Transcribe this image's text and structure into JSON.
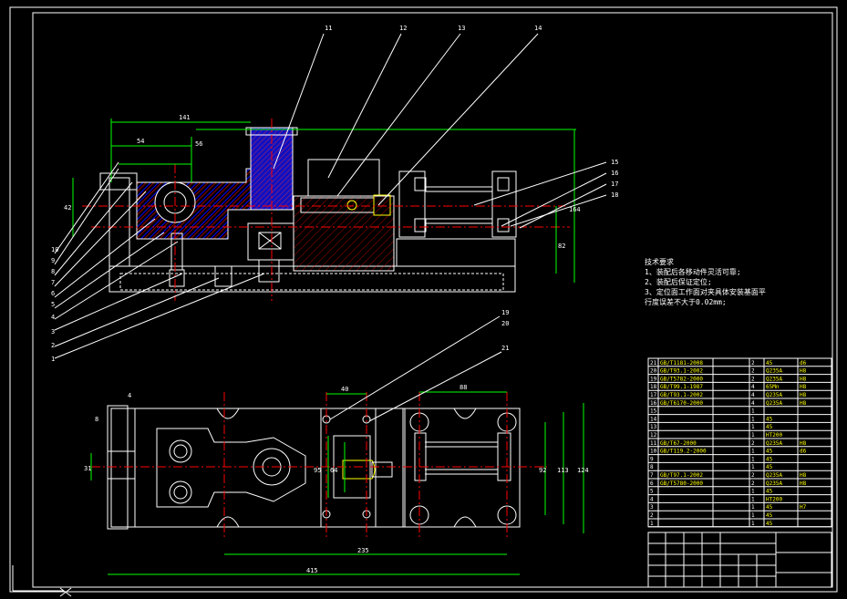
{
  "drawing": {
    "balloons_front": [
      "11",
      "12",
      "13",
      "14",
      "15",
      "16",
      "17",
      "18"
    ],
    "balloons_left": [
      "10",
      "9",
      "8",
      "7",
      "6",
      "5",
      "4",
      "3",
      "2",
      "1"
    ],
    "balloons_top": [
      "19",
      "20",
      "21"
    ],
    "dims_front": [
      "141",
      "54",
      "42",
      "56",
      "164",
      "82"
    ],
    "dims_top": [
      "40",
      "88",
      "4",
      "8",
      "31",
      "95",
      "64",
      "92",
      "113",
      "124",
      "235",
      "415"
    ]
  },
  "notes": {
    "heading": "技术要求",
    "lines": [
      "1、装配后各移动件灵活可靠;",
      "2、装配后保证定位;",
      "3、定位面工作面对夹具体安装基面平",
      "行度误差不大于0.02mm;"
    ]
  },
  "bom": {
    "rows": [
      [
        "21",
        "GB/T1181-2008",
        "",
        "2",
        "45",
        "d6"
      ],
      [
        "20",
        "GB/T93.1-2002",
        "",
        "2",
        "Q235A",
        "H8"
      ],
      [
        "19",
        "GB/T5782-2000",
        "",
        "2",
        "Q235A",
        "H8"
      ],
      [
        "18",
        "GB/T99.1-1987",
        "",
        "4",
        "65Mn",
        "H8"
      ],
      [
        "17",
        "GB/T93.1-2002",
        "",
        "4",
        "Q235A",
        "H8"
      ],
      [
        "16",
        "GB/T6170-2000",
        "",
        "4",
        "Q235A",
        "H8"
      ],
      [
        "15",
        "",
        "",
        "1",
        "",
        ""
      ],
      [
        "14",
        "",
        "",
        "1",
        "45",
        ""
      ],
      [
        "13",
        "",
        "",
        "1",
        "45",
        ""
      ],
      [
        "12",
        "",
        "",
        "1",
        "HT200",
        ""
      ],
      [
        "11",
        "GB/T67-2000",
        "",
        "2",
        "Q235A",
        "H8"
      ],
      [
        "10",
        "GB/T119.2-2000",
        "",
        "1",
        "45",
        "d6"
      ],
      [
        "9",
        "",
        "",
        "1",
        "45",
        ""
      ],
      [
        "8",
        "",
        "",
        "1",
        "45",
        ""
      ],
      [
        "7",
        "GB/T97.1-2002",
        "",
        "2",
        "Q235A",
        "H8"
      ],
      [
        "6",
        "GB/T5780-2000",
        "",
        "2",
        "Q235A",
        "H8"
      ],
      [
        "5",
        "",
        "",
        "1",
        "45",
        ""
      ],
      [
        "4",
        "",
        "",
        "1",
        "HT200",
        ""
      ],
      [
        "3",
        "",
        "",
        "1",
        "45",
        "H7"
      ],
      [
        "2",
        "",
        "",
        "1",
        "45",
        ""
      ],
      [
        "1",
        "",
        "",
        "1",
        "45",
        ""
      ]
    ]
  },
  "title_block": {}
}
